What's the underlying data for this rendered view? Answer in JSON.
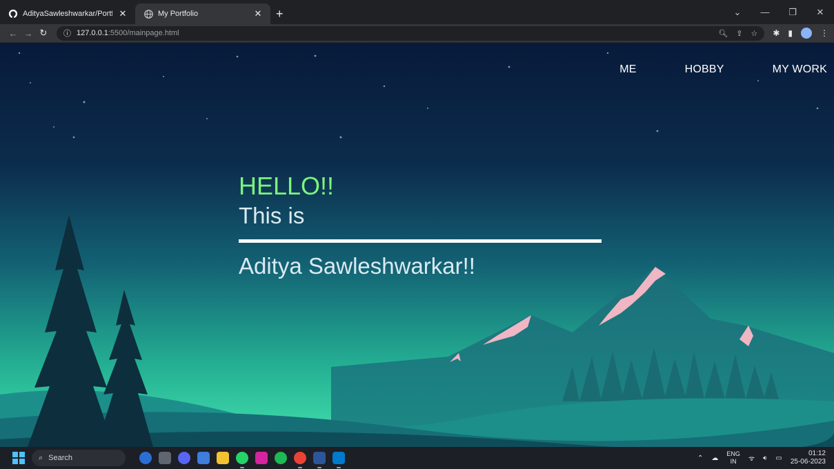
{
  "browser": {
    "tabs": [
      {
        "title": "AdityaSawleshwarkar/Portfolio",
        "icon": "github-icon",
        "active": false
      },
      {
        "title": "My Portfolio",
        "icon": "globe-icon",
        "active": true
      }
    ],
    "address": {
      "host": "127.0.0.1",
      "rest": ":5500/mainpage.html"
    }
  },
  "page": {
    "nav": [
      "ME",
      "HOBBY",
      "MY WORK"
    ],
    "hello": "HELLO!!",
    "this_is": "This is",
    "name": "Aditya Sawleshwarkar!!"
  },
  "taskbar": {
    "search_placeholder": "Search",
    "lang_top": "ENG",
    "lang_bottom": "IN",
    "time": "01:12",
    "date": "25-06-2023"
  },
  "colors": {
    "hello": "#7cf57a",
    "text": "#dbeaf2",
    "chrome_dark": "#202124",
    "chrome_toolbar": "#35363a"
  }
}
